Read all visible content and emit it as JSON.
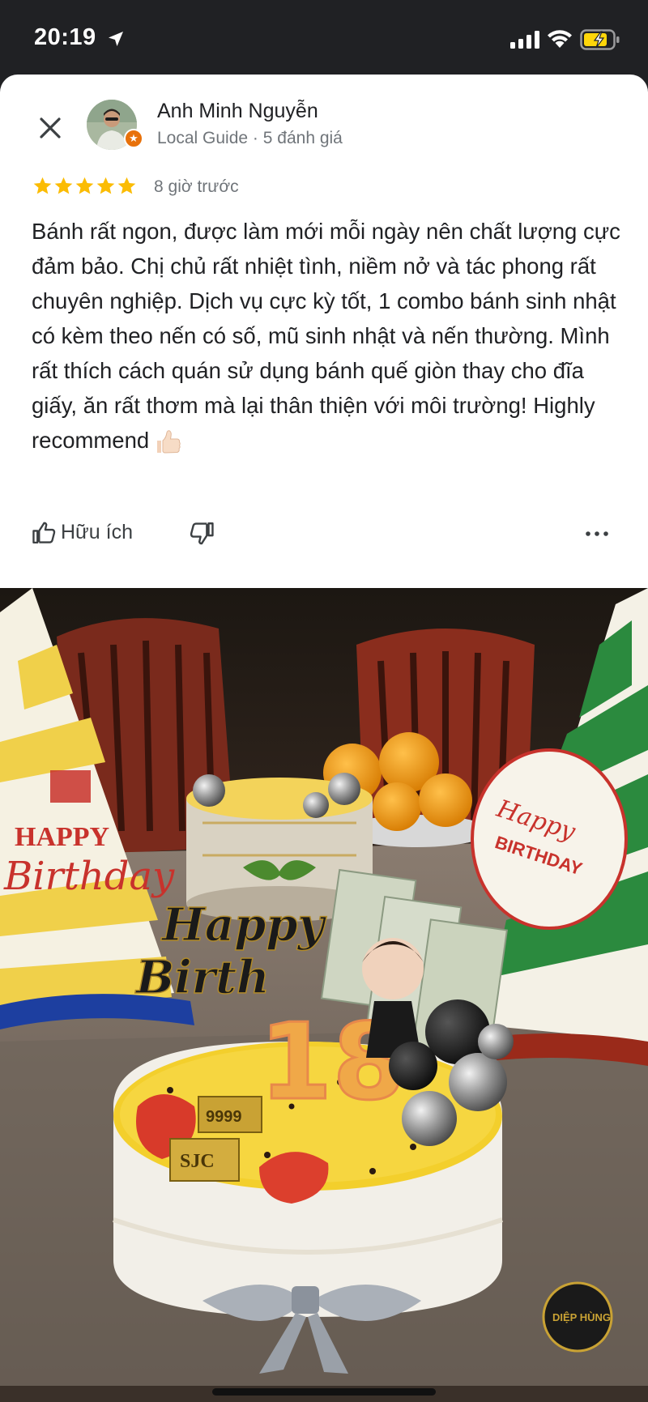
{
  "status_bar": {
    "time": "20:19"
  },
  "review": {
    "author_name": "Anh Minh Nguyễn",
    "author_level": "Local Guide",
    "separator": "·",
    "review_count": "5 đánh giá",
    "rating": 5,
    "time_ago": "8 giờ trước",
    "text": "Bánh rất ngon, được làm mới mỗi ngày nên chất lượng cực đảm bảo. Chị chủ rất nhiệt tình, niềm nở và tác phong rất chuyên nghiệp. Dịch vụ cực kỳ tốt, 1 combo bánh sinh nhật có kèm theo nến có số, mũ sinh nhật và nến thường. Mình rất thích cách quán sử dụng bánh quế giòn thay cho đĩa giấy, ăn rất thơm mà lại thân thiện với môi trường! Highly recommend"
  },
  "actions": {
    "helpful_label": "Hữu ích"
  },
  "photo": {
    "hat_left_text": "HAPPY",
    "hat_left_script": "Birthday",
    "hat_right_script": "Happy",
    "hat_right_text": "BIRTHDAY",
    "topper_script_1": "Happy",
    "topper_script_2": "Birth",
    "candle_number": "18",
    "gold_bar_1": "9999",
    "gold_bar_2": "SJC",
    "logo_text": "DIỆP HÙNG"
  },
  "icons": {
    "close": "close-icon",
    "stars": "star-icon",
    "helpful": "thumb-up-icon",
    "not_helpful": "thumb-down-icon",
    "more": "more-horizontal-icon"
  },
  "colors": {
    "star": "#fbbc04",
    "guide_badge": "#e8710a",
    "text_primary": "#202124",
    "text_secondary": "#70757a"
  }
}
